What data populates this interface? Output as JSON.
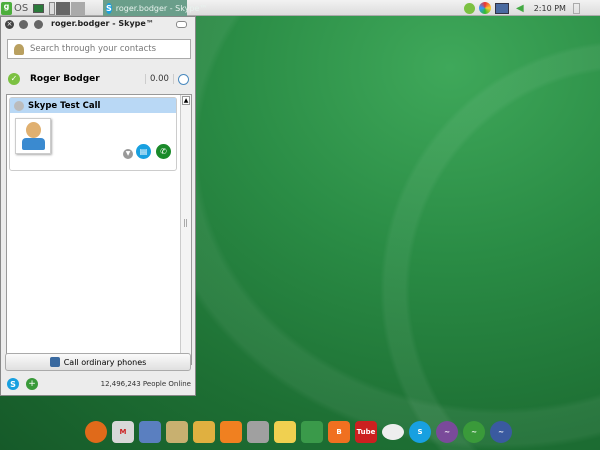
{
  "taskbar": {
    "os_label": "OS",
    "active_window": "roger.bodger - Skype™",
    "clock": "2:10 PM"
  },
  "window": {
    "title": "roger.bodger - Skype™"
  },
  "search": {
    "placeholder": "Search through your contacts"
  },
  "user": {
    "name": "Roger Bodger",
    "credit": "0.00"
  },
  "contacts": [
    {
      "name": "Skype Test Call"
    }
  ],
  "call_phones_label": "Call ordinary phones",
  "status_bar": {
    "online_count": "12,496,243 People Online"
  },
  "dock": [
    {
      "name": "firefox",
      "color": "#e06a1a",
      "glyph": ""
    },
    {
      "name": "gmail",
      "color": "#d8d8d8",
      "glyph": "M"
    },
    {
      "name": "calendar",
      "color": "#5a7fc0",
      "glyph": ""
    },
    {
      "name": "paint",
      "color": "#c8b070",
      "glyph": ""
    },
    {
      "name": "files",
      "color": "#e0b040",
      "glyph": ""
    },
    {
      "name": "rss",
      "color": "#f08020",
      "glyph": ""
    },
    {
      "name": "news",
      "color": "#a0a0a0",
      "glyph": ""
    },
    {
      "name": "shopping",
      "color": "#f0d050",
      "glyph": ""
    },
    {
      "name": "finance",
      "color": "#3a9a4a",
      "glyph": ""
    },
    {
      "name": "blogger",
      "color": "#f07020",
      "glyph": "B"
    },
    {
      "name": "youtube",
      "color": "#cc2020",
      "glyph": "Tube"
    },
    {
      "name": "chat",
      "color": "#eeeeee",
      "glyph": ""
    },
    {
      "name": "skype",
      "color": "#18a0e0",
      "glyph": "S"
    },
    {
      "name": "openoffice-impress",
      "color": "#7a4a9a",
      "glyph": "~"
    },
    {
      "name": "openoffice-calc",
      "color": "#3a9a3a",
      "glyph": "~"
    },
    {
      "name": "openoffice-writer",
      "color": "#3a5aa0",
      "glyph": "~"
    }
  ]
}
